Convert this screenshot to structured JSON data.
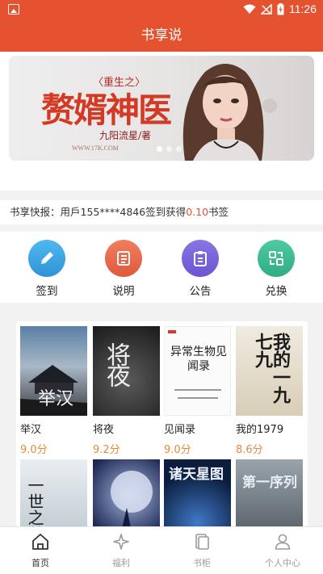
{
  "status_bar": {
    "time": "11:26"
  },
  "header": {
    "title": "书享说"
  },
  "banner": {
    "subtitle": "〈重生之〉",
    "title": "赘婿神医",
    "author": "九阳流星/著",
    "site": "WWW.17K.COM",
    "dot_count": 3,
    "active_dot": 0
  },
  "news": {
    "prefix": "书享快报：",
    "text_before": "用戶155****4846签到获得",
    "highlight": "0.10",
    "text_after": "书签"
  },
  "menu": [
    {
      "label": "签到",
      "icon": "pencil-icon",
      "color": "#3aa6e0"
    },
    {
      "label": "说明",
      "icon": "list-icon",
      "color": "#e4674a"
    },
    {
      "label": "公告",
      "icon": "clipboard-icon",
      "color": "#7a63d8"
    },
    {
      "label": "兑换",
      "icon": "exchange-icon",
      "color": "#3dba93"
    }
  ],
  "books": [
    {
      "name": "举汉",
      "score": "9.0分",
      "cover_text": "举汉"
    },
    {
      "name": "将夜",
      "score": "9.2分",
      "cover_text": "将夜"
    },
    {
      "name": "见闻录",
      "score": "9.0分",
      "cover_text": "异常生物见闻录"
    },
    {
      "name": "我的1979",
      "score": "8.6分",
      "cover_text": "我的一九七九"
    },
    {
      "name": "",
      "score": "",
      "cover_text": "一世之尊"
    },
    {
      "name": "",
      "score": "",
      "cover_text": ""
    },
    {
      "name": "",
      "score": "",
      "cover_text": "诸天星图"
    },
    {
      "name": "",
      "score": "",
      "cover_text": "第一序列"
    }
  ],
  "tabs": [
    {
      "label": "首页",
      "icon": "home-icon",
      "active": true
    },
    {
      "label": "福利",
      "icon": "sparkle-icon",
      "active": false
    },
    {
      "label": "书柜",
      "icon": "bookshelf-icon",
      "active": false
    },
    {
      "label": "个人中心",
      "icon": "person-icon",
      "active": false
    }
  ],
  "colors": {
    "brand": "#e4522f",
    "score": "#e58a37"
  }
}
